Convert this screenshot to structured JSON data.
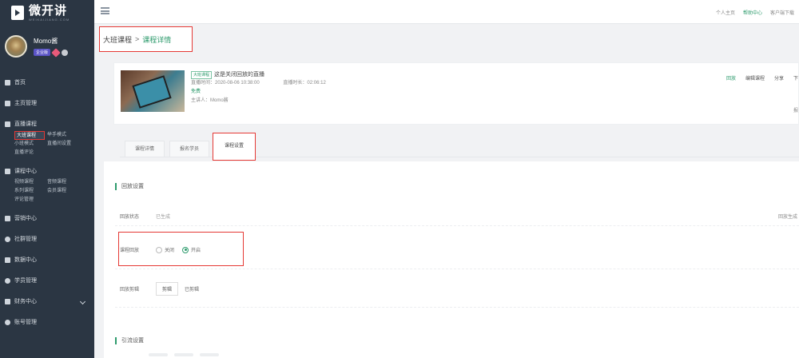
{
  "brand": {
    "name": "微开讲",
    "sub": "WEIKAIJIANG.COM"
  },
  "user": {
    "name": "Momo酱",
    "badge": "企业版"
  },
  "menu": [
    {
      "label": "首页"
    },
    {
      "label": "主页管理"
    },
    {
      "label": "直播课程",
      "sub": [
        "大班课程",
        "举手模式",
        "小班模式",
        "直播间设置",
        "直播评论"
      ]
    },
    {
      "label": "课程中心",
      "sub": [
        "视频课程",
        "音频课程",
        "系列课程",
        "会员课程",
        "评论管理"
      ]
    },
    {
      "label": "营销中心"
    },
    {
      "label": "社群管理"
    },
    {
      "label": "数据中心"
    },
    {
      "label": "学员管理"
    },
    {
      "label": "财务中心"
    },
    {
      "label": "账号管理"
    }
  ],
  "topbar": {
    "links": [
      "个人主页",
      "帮助中心",
      "客户端下载"
    ]
  },
  "breadcrumb": {
    "parent": "大班课程",
    "sep": ">",
    "current": "课程详情"
  },
  "course": {
    "tag": "大班课程",
    "title": "这是关闭回放的直播",
    "start_label": "直播时间：",
    "start": "2020-08-06 10:38:00",
    "duration_label": "直播时长：",
    "duration": "02:06:12",
    "price": "免费",
    "host_label": "主讲人：",
    "host": "Momo酱",
    "actions": [
      "回放",
      "编辑课程",
      "分享",
      "下"
    ],
    "more": "报"
  },
  "tabs": [
    "课程详情",
    "报名学员",
    "课程设置"
  ],
  "settings": {
    "replay_section": "回放设置",
    "replay_status_label": "回放状态",
    "replay_status": "已生成",
    "replay_status_right": "回放生成",
    "replay_label": "课程回放",
    "replay_off": "关闭",
    "replay_on": "开启",
    "edit_label": "回放剪辑",
    "edit_btn": "剪辑",
    "edit_done": "已剪辑",
    "guide_section": "引流设置"
  }
}
